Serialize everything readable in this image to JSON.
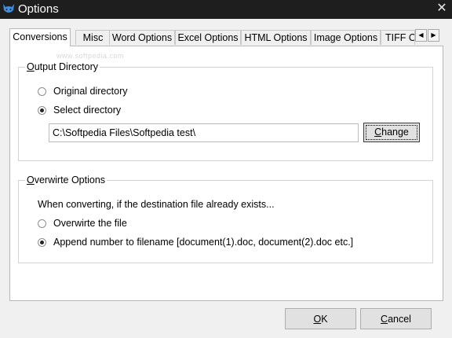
{
  "window": {
    "title": "Options",
    "app_icon": "cat-app-icon",
    "close_glyph": "✕"
  },
  "tabs": [
    {
      "label": "Conversions",
      "active": true
    },
    {
      "label": "Misc",
      "active": false
    },
    {
      "label": "Word Options",
      "active": false
    },
    {
      "label": "Excel Options",
      "active": false
    },
    {
      "label": "HTML Options",
      "active": false
    },
    {
      "label": "Image Options",
      "active": false
    },
    {
      "label": "TIFF O",
      "active": false
    }
  ],
  "tab_scroll": {
    "left_glyph": "◀",
    "right_glyph": "▶"
  },
  "watermark": "www.softpedia.com",
  "output_directory": {
    "title_u": "O",
    "title_rest": "utput Directory",
    "original_label": "Original directory",
    "original_checked": false,
    "select_label": "Select directory",
    "select_checked": true,
    "path_value": "C:\\Softpedia Files\\Softpedia test\\",
    "change_u": "C",
    "change_rest": "hange"
  },
  "overwrite_options": {
    "title_u": "O",
    "title_rest": "verwirte Options",
    "prompt": "When converting, if the destination file already exists...",
    "overwrite_label": "Overwirte the file",
    "overwrite_checked": false,
    "append_label": "Append number to filename  [document(1).doc, document(2).doc etc.]",
    "append_checked": true
  },
  "footer": {
    "ok_u": "O",
    "ok_rest": "K",
    "cancel_u": "C",
    "cancel_rest": "ancel"
  },
  "colors": {
    "titlebar": "#1e1e1e",
    "dialog_bg": "#f0f0f0",
    "panel_bg": "#ffffff",
    "icon_blue": "#3d8fe0"
  }
}
